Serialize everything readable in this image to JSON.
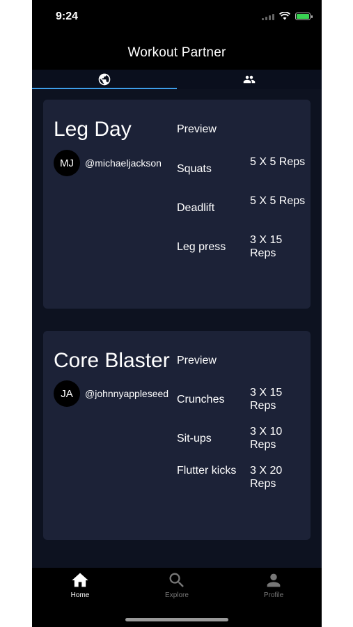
{
  "status": {
    "time": "9:24"
  },
  "app": {
    "title": "Workout Partner"
  },
  "tabs": [
    {
      "icon": "globe-icon",
      "active": true
    },
    {
      "icon": "people-icon",
      "active": false
    }
  ],
  "workouts": [
    {
      "title": "Leg Day",
      "avatar_initials": "MJ",
      "username": "@michaeljackson",
      "preview_label": "Preview",
      "exercises": [
        {
          "name": "Squats",
          "reps": "5 X 5 Reps"
        },
        {
          "name": "Deadlift",
          "reps": "5 X 5 Reps"
        },
        {
          "name": "Leg press",
          "reps": "3 X 15 Reps"
        }
      ]
    },
    {
      "title": "Core Blaster",
      "avatar_initials": "JA",
      "username": "@johnnyappleseed",
      "preview_label": "Preview",
      "exercises": [
        {
          "name": "Crunches",
          "reps": "3 X 15 Reps"
        },
        {
          "name": "Sit-ups",
          "reps": "3 X 10 Reps"
        },
        {
          "name": "Flutter kicks",
          "reps": "3 X 20 Reps"
        }
      ]
    }
  ],
  "bottom_nav": [
    {
      "label": "Home",
      "icon": "home-icon",
      "active": true
    },
    {
      "label": "Explore",
      "icon": "search-icon",
      "active": false
    },
    {
      "label": "Profile",
      "icon": "person-icon",
      "active": false
    }
  ],
  "colors": {
    "background": "#0d1220",
    "card": "#1c2237",
    "accent": "#3e9ee9",
    "battery": "#39d353"
  }
}
